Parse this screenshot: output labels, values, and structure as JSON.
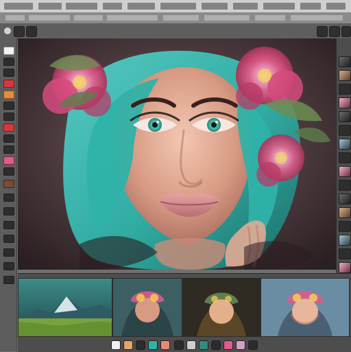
{
  "app": {
    "window_title": ""
  },
  "icons": {
    "toolbar": [
      "tool-icon",
      "tool-icon",
      "tool-icon",
      "tool-icon",
      "tool-icon",
      "tool-icon",
      "tool-icon",
      "tool-icon",
      "tool-icon",
      "tool-icon",
      "tool-icon",
      "tool-icon",
      "tool-icon",
      "tool-icon",
      "tool-icon",
      "tool-icon",
      "tool-icon",
      "tool-icon",
      "tool-icon",
      "tool-icon"
    ],
    "bottom_toolbar": [
      "color-swatch-icon",
      "color-swatch-icon",
      "color-swatch-icon",
      "color-swatch-icon",
      "color-swatch-icon",
      "color-swatch-icon",
      "color-swatch-icon",
      "color-swatch-icon",
      "color-swatch-icon",
      "color-swatch-icon",
      "color-swatch-icon",
      "color-swatch-icon"
    ]
  },
  "filmstrip": {
    "thumbnails": [
      "landscape-mountain-thumbnail",
      "woman-flower-crown-thumbnail",
      "woman-flower-crown-thumbnail",
      "woman-flower-crown-thumbnail"
    ]
  },
  "colors": {
    "canvas_background": "#4b3c3f",
    "hair_teal": "#2fb2a8",
    "flower_pink": "#e05b8a",
    "eye_green": "#3aa996"
  }
}
